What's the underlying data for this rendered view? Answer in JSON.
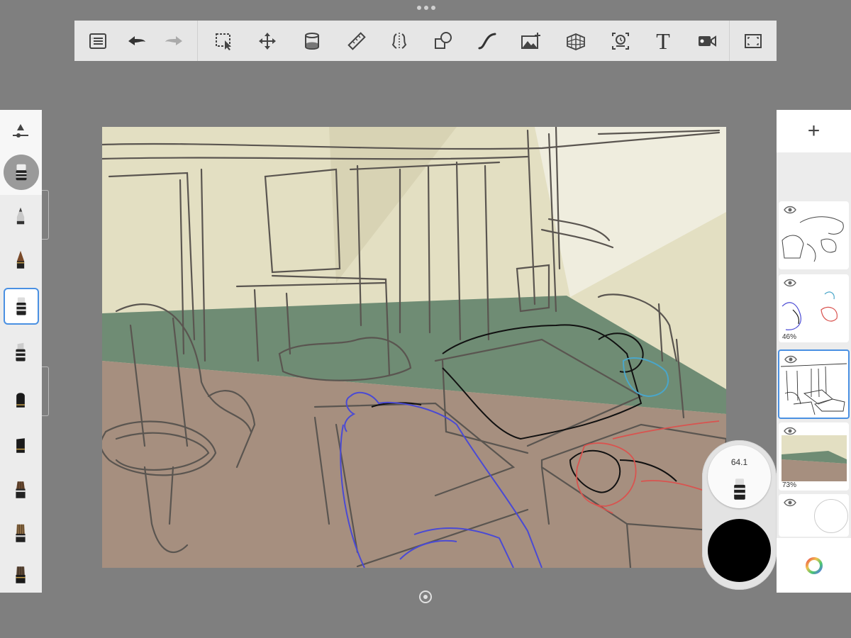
{
  "window": {
    "top_dots_icon": "more-dots-icon"
  },
  "toolbar": {
    "tools": [
      {
        "name": "layers-list-icon"
      },
      {
        "name": "undo-icon"
      },
      {
        "name": "redo-icon"
      },
      {
        "name": "selection-icon"
      },
      {
        "name": "transform-icon"
      },
      {
        "name": "fill-bucket-icon"
      },
      {
        "name": "ruler-icon"
      },
      {
        "name": "symmetry-icon"
      },
      {
        "name": "shapes-icon"
      },
      {
        "name": "curve-icon"
      },
      {
        "name": "add-image-icon"
      },
      {
        "name": "perspective-grid-icon"
      },
      {
        "name": "time-lapse-icon"
      },
      {
        "name": "text-icon"
      },
      {
        "name": "video-record-icon"
      },
      {
        "name": "fullscreen-icon"
      }
    ],
    "text_tool_label": "T"
  },
  "brushes": {
    "current_brush_icon": "current-brush-icon",
    "size_slider_icon": "brush-size-slider-icon",
    "items": [
      "pencil",
      "ink-pen",
      "marker",
      "chisel-marker",
      "soft-brush",
      "hard-brush",
      "paint-brush",
      "bristle-brush",
      "flat-brush"
    ],
    "selected_index": 2
  },
  "layers": {
    "add_label": "+",
    "items": [
      {
        "name": "layer-sketch-pillows",
        "opacity": ""
      },
      {
        "name": "layer-color-sketch",
        "opacity": "46%"
      },
      {
        "name": "layer-room-sketch",
        "opacity": "",
        "selected": true
      },
      {
        "name": "layer-color-fill",
        "opacity": "73%"
      },
      {
        "name": "layer-background",
        "opacity": ""
      }
    ],
    "color_wheel_icon": "color-wheel-icon"
  },
  "puck": {
    "brush_size": "64.1",
    "current_color": "#000000"
  },
  "colors": {
    "wall": "#e3dfc2",
    "wainscot": "#6f8c74",
    "floor": "#a68f7f",
    "stroke": "#5a5550",
    "accent": "#4a90e2"
  }
}
